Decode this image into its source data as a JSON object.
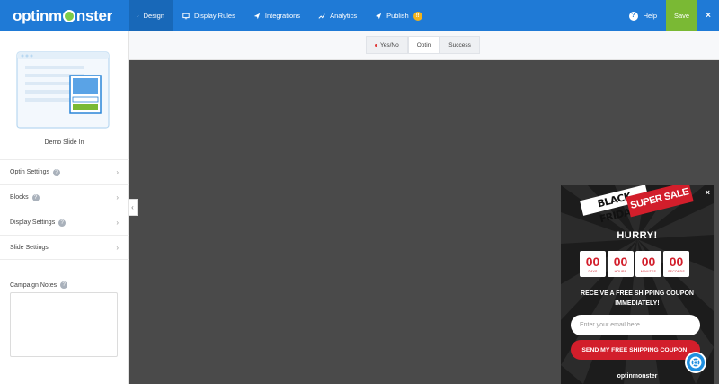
{
  "app": {
    "logo_text_pre": "optinm",
    "logo_text_post": "nster"
  },
  "topbar": {
    "tabs": [
      {
        "label": "Design",
        "icon": "brush-icon",
        "active": true
      },
      {
        "label": "Display Rules",
        "icon": "monitor-icon"
      },
      {
        "label": "Integrations",
        "icon": "plane-icon"
      },
      {
        "label": "Analytics",
        "icon": "chart-icon"
      },
      {
        "label": "Publish",
        "icon": "send-icon",
        "badge": "!!"
      }
    ],
    "help_label": "Help",
    "help_icon_text": "?",
    "save_label": "Save",
    "close_label": "×"
  },
  "sidebar": {
    "demo_label": "Demo Slide In",
    "sections": [
      {
        "label": "Optin Settings"
      },
      {
        "label": "Blocks"
      },
      {
        "label": "Display Settings"
      },
      {
        "label": "Slide Settings"
      }
    ],
    "info_icon_text": "?",
    "chevron": "›",
    "notes_label": "Campaign Notes",
    "collapse_glyph": "‹"
  },
  "view_tabs": [
    {
      "label": "Yes/No",
      "has_dot": true
    },
    {
      "label": "Optin",
      "active": true
    },
    {
      "label": "Success"
    }
  ],
  "slidein": {
    "close": "×",
    "headline_1": "BLACK FRIDAY",
    "headline_2": "SUPER SALE",
    "hurry": "HURRY!",
    "timer": [
      {
        "value": "00",
        "unit": "DAYS"
      },
      {
        "value": "00",
        "unit": "HOURS"
      },
      {
        "value": "00",
        "unit": "MINUTES"
      },
      {
        "value": "00",
        "unit": "SECONDS"
      }
    ],
    "offer_text": "RECEIVE A FREE SHIPPING COUPON IMMEDIATELY!",
    "email_placeholder": "Enter your email here...",
    "button_label": "SEND MY FREE SHIPPING COUPON!",
    "footer_logo": "optinmonster"
  },
  "colors": {
    "topbar": "#1f7ad6",
    "save": "#7ab934",
    "accent_red": "#d21e2b",
    "canvas": "#4a4a4a"
  }
}
